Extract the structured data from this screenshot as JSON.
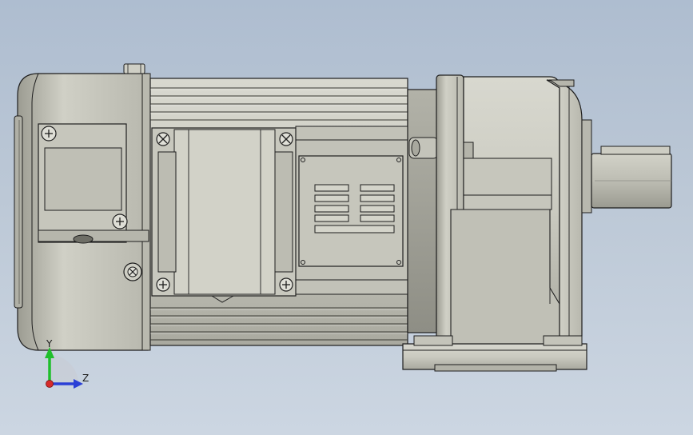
{
  "viewport": {
    "background_top": "#aebdd0",
    "background_bottom": "#ccd6e2",
    "model": "gear-motor",
    "display_mode": "shaded-with-edges",
    "body_color": "#c9c9bf",
    "edge_color": "#1e1e1e"
  },
  "triad": {
    "y_label": "Y",
    "z_label": "Z",
    "y_color": "#1fbf2c",
    "z_color": "#2a3fd6",
    "x_color": "#d62a2a"
  }
}
